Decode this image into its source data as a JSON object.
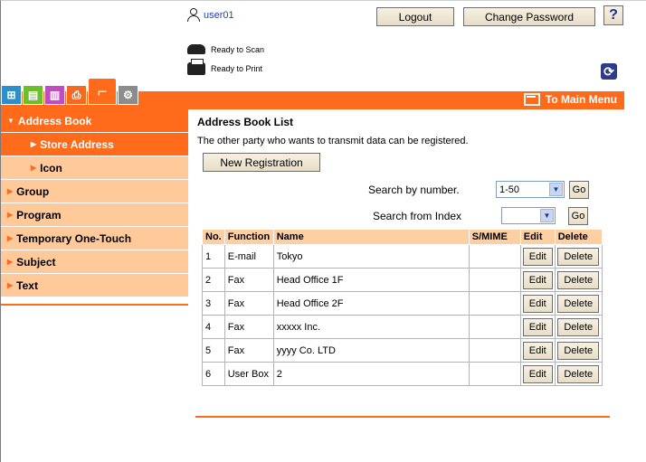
{
  "header": {
    "user": "user01",
    "logout_label": "Logout",
    "change_password_label": "Change Password",
    "help_label": "?",
    "status_scan": "Ready to Scan",
    "status_print": "Ready to Print"
  },
  "toolbar": {
    "to_main_menu": "To Main Menu"
  },
  "sidebar": {
    "items": [
      {
        "label": "Address Book"
      },
      {
        "label": "Store Address"
      },
      {
        "label": "Icon"
      },
      {
        "label": "Group"
      },
      {
        "label": "Program"
      },
      {
        "label": "Temporary One-Touch"
      },
      {
        "label": "Subject"
      },
      {
        "label": "Text"
      }
    ]
  },
  "main": {
    "title": "Address Book List",
    "description": "The other party who wants to transmit data can be registered.",
    "new_registration_label": "New Registration",
    "search_by_number_label": "Search by number.",
    "search_by_number_value": "1-50",
    "search_from_index_label": "Search from Index",
    "search_from_index_value": "",
    "go_label": "Go",
    "table": {
      "headers": [
        "No.",
        "Function",
        "Name",
        "S/MIME",
        "Edit",
        "Delete"
      ],
      "edit_label": "Edit",
      "delete_label": "Delete",
      "rows": [
        {
          "no": "1",
          "function": "E-mail",
          "name": "Tokyo",
          "smime": ""
        },
        {
          "no": "2",
          "function": "Fax",
          "name": "Head Office 1F",
          "smime": ""
        },
        {
          "no": "3",
          "function": "Fax",
          "name": "Head Office 2F",
          "smime": ""
        },
        {
          "no": "4",
          "function": "Fax",
          "name": "xxxxx Inc.",
          "smime": ""
        },
        {
          "no": "5",
          "function": "Fax",
          "name": "yyyy Co. LTD",
          "smime": ""
        },
        {
          "no": "6",
          "function": "User Box",
          "name": "2",
          "smime": ""
        }
      ]
    }
  },
  "colors": {
    "accent": "#ff6b1a",
    "nav_bg": "#ffc99a",
    "table_header_bg": "#ffcfa4"
  }
}
